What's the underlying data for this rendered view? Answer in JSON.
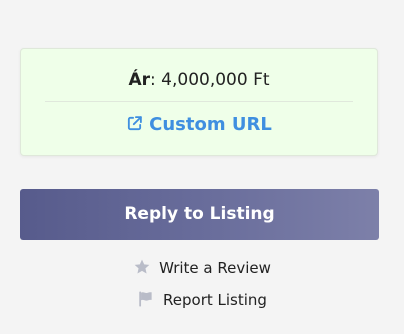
{
  "price": {
    "label": "Ár",
    "separator": ": ",
    "value": "4,000,000 Ft"
  },
  "custom_url": {
    "label": "Custom URL",
    "icon": "external-link-icon"
  },
  "reply_button": {
    "label": "Reply to Listing"
  },
  "actions": [
    {
      "label": "Write a Review",
      "icon": "star-icon"
    },
    {
      "label": "Report Listing",
      "icon": "flag-icon"
    }
  ],
  "colors": {
    "card_background": "#efffe9",
    "link": "#3f8fe0",
    "button_gradient_start": "#575b8c",
    "button_gradient_end": "#7d80a9",
    "icon_gray": "#b9bcc8"
  }
}
